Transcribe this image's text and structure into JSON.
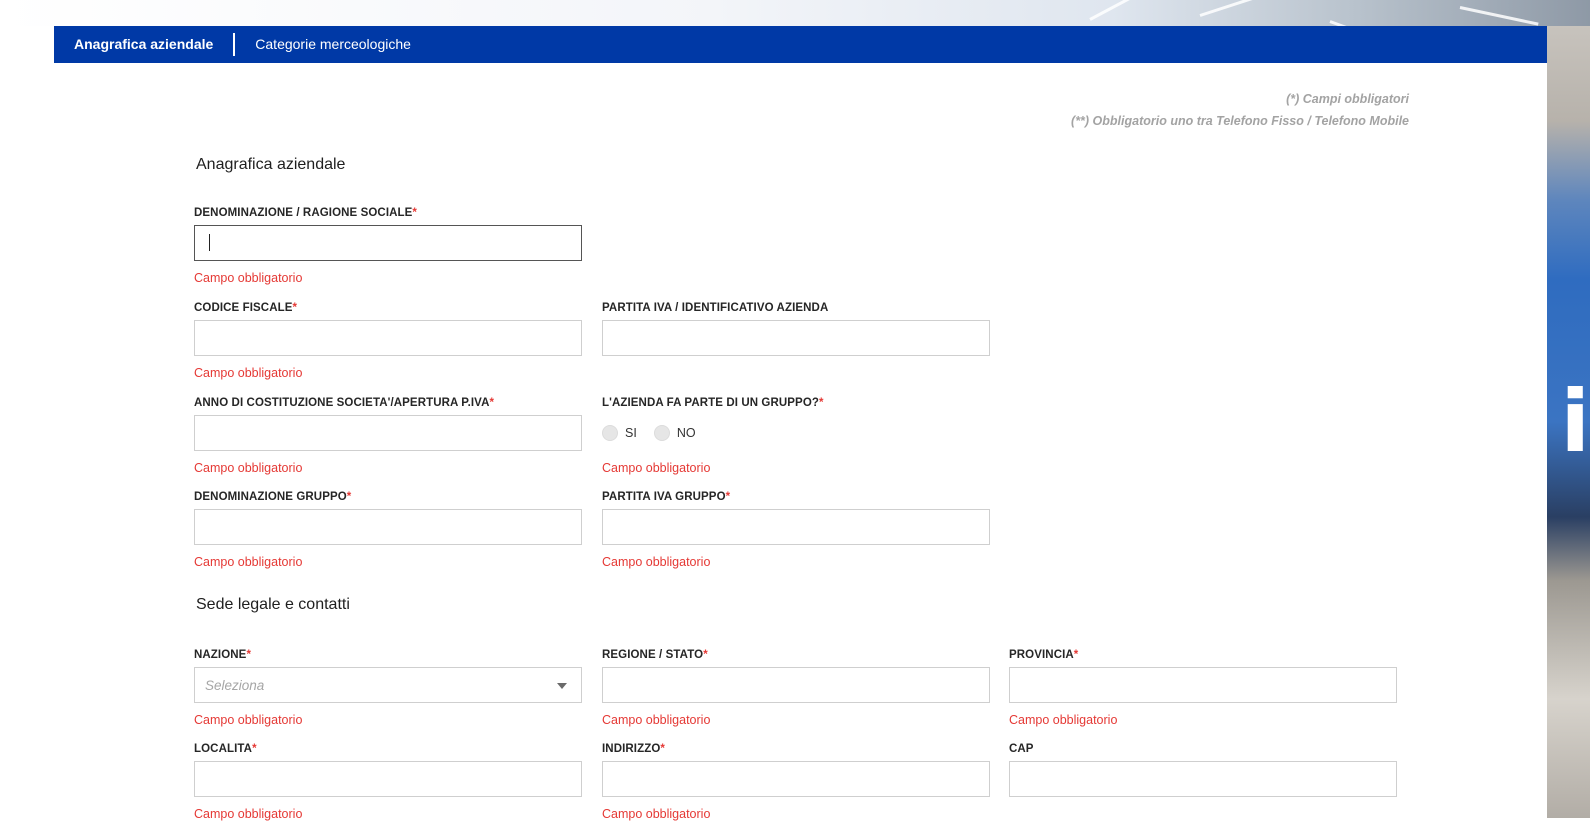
{
  "tabs": [
    {
      "label": "Anagrafica aziendale",
      "active": true
    },
    {
      "label": "Categorie merceologiche",
      "active": false
    }
  ],
  "notes": {
    "required": "(*) Campi obbligatori",
    "phone_required": "(**) Obbligatorio uno tra Telefono Fisso / Telefono Mobile"
  },
  "sections": {
    "company": "Anagrafica aziendale",
    "legal_office": "Sede legale e contatti"
  },
  "required_marker": "*",
  "error_text": "Campo obbligatorio",
  "fields": {
    "denominazione": {
      "label": "DENOMINAZIONE / RAGIONE SOCIALE",
      "value": ""
    },
    "codice_fiscale": {
      "label": "CODICE FISCALE",
      "value": ""
    },
    "partita_iva": {
      "label": "PARTITA IVA / IDENTIFICATIVO AZIENDA",
      "value": ""
    },
    "anno": {
      "label": "ANNO DI COSTITUZIONE SOCIETA'/APERTURA P.IVA",
      "value": ""
    },
    "gruppo_question": {
      "label": "L'AZIENDA FA PARTE DI UN GRUPPO?",
      "options": [
        "SI",
        "NO"
      ]
    },
    "denominazione_gruppo": {
      "label": "DENOMINAZIONE GRUPPO",
      "value": ""
    },
    "partita_iva_gruppo": {
      "label": "PARTITA IVA GRUPPO",
      "value": ""
    },
    "nazione": {
      "label": "NAZIONE",
      "placeholder": "Seleziona"
    },
    "regione": {
      "label": "REGIONE / STATO",
      "value": ""
    },
    "provincia": {
      "label": "PROVINCIA",
      "value": ""
    },
    "localita": {
      "label": "LOCALITA",
      "value": ""
    },
    "indirizzo": {
      "label": "INDIRIZZO",
      "value": ""
    },
    "cap": {
      "label": "CAP",
      "value": ""
    }
  },
  "background": {
    "info_glyph": "i"
  },
  "colors": {
    "nav": "#0039a6",
    "error": "#e53935",
    "muted": "#a3a3a3"
  }
}
